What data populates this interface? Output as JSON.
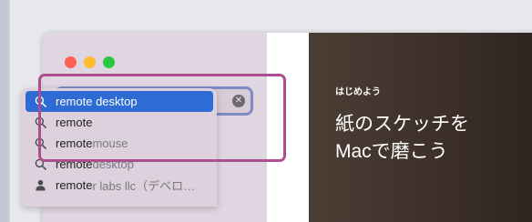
{
  "window": {
    "traffic_lights": {
      "close": "#fe5f57",
      "minimize": "#febc2e",
      "zoom": "#28c840"
    }
  },
  "search": {
    "value": "remote",
    "icon": "magnifying-glass-icon",
    "clear_icon": "clear-x-icon",
    "clear_glyph": "✕"
  },
  "suggestions": [
    {
      "text": "remote desktop",
      "rest": "",
      "icon": "search-icon",
      "selected": true
    },
    {
      "text": "remote",
      "rest": "",
      "icon": "search-icon",
      "selected": false
    },
    {
      "text": "remote",
      "rest": " mouse",
      "icon": "search-icon",
      "selected": false
    },
    {
      "text": "remote",
      "rest": "desktop",
      "icon": "search-icon",
      "selected": false
    },
    {
      "text": "remote",
      "rest": "r labs llc（デベロ…",
      "icon": "person-icon",
      "selected": false
    }
  ],
  "banner": {
    "eyebrow": "はじめよう",
    "title": "紙のスケッチを Macで磨こう"
  },
  "colors": {
    "selection": "#2f6bd5",
    "highlight_outline": "#ad4f8f",
    "search_focus": "#7d8ac4"
  }
}
